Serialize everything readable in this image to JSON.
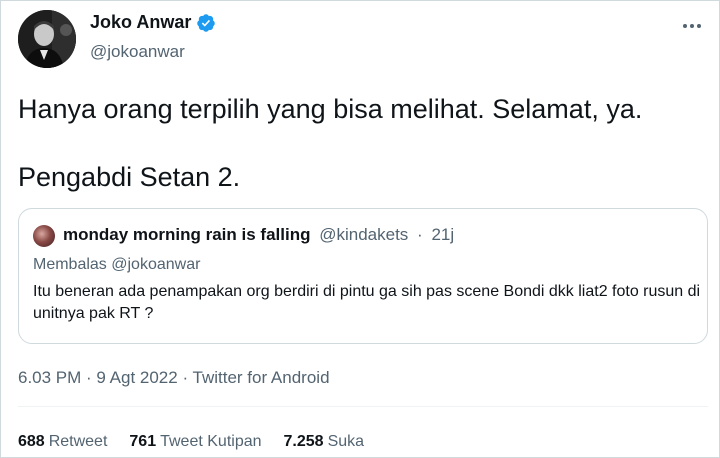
{
  "author": {
    "name": "Joko Anwar",
    "handle": "@jokoanwar",
    "avatar_icon": "profile-photo-icon",
    "verified_icon": "verified-badge-icon",
    "verified_color": "#1d9bf0"
  },
  "tweet": {
    "line1": "Hanya orang terpilih yang bisa melihat. Selamat, ya.",
    "line2": "Pengabdi Setan 2."
  },
  "quote": {
    "name": "monday morning rain is falling",
    "handle": "@kindakets",
    "separator": "·",
    "time": "21j",
    "replying_to": "Membalas @jokoanwar",
    "text": "Itu beneran ada penampakan org berdiri di pintu ga sih pas scene Bondi dkk liat2 foto rusun di unitnya pak RT ?"
  },
  "meta": {
    "text": "6.03 PM · 9 Agt 2022 · Twitter for Android"
  },
  "stats": [
    {
      "count": "688",
      "label": "Retweet"
    },
    {
      "count": "761",
      "label": "Tweet Kutipan"
    },
    {
      "count": "7.258",
      "label": "Suka"
    }
  ],
  "more_icon": "more-options-icon"
}
